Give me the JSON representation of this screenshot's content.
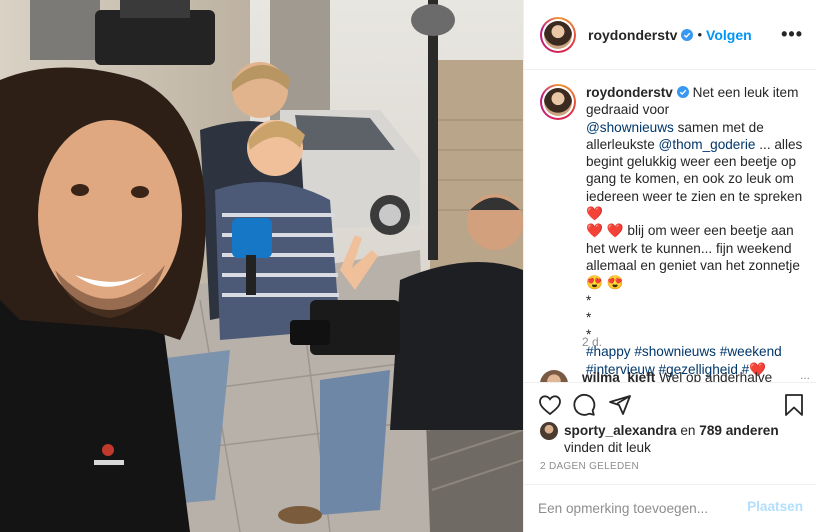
{
  "post": {
    "username": "roydonderstv",
    "follow_label": "Volgen",
    "separator": "•",
    "more_label": "•••",
    "photo_alt": "Selfie van een tv-ploeg met camera en microfoonhengel op straat"
  },
  "caption": {
    "username": "roydonderstv",
    "part1": "Net een leuk item gedraaid voor\n",
    "mention1": "@shownieuws",
    "part2": " samen met de allerleukste ",
    "mention2": "@thom_goderie",
    "part3": " ... alles begint gelukkig weer een beetje op gang te komen, en ook zo leuk om iedereen weer te zien en te spreken",
    "heart1": "❤️",
    "heart2": "❤️ ❤️",
    "part4": "  blij om weer een beetje aan het werk te kunnen... fijn weekend allemaal en geniet van het zonnetje",
    "emoji_end": "😍 😍",
    "bullets": "*\n*\n*",
    "hashtags": "#happy #shownieuws #weekend #intervieuw #gezelligheid #",
    "heart3": "❤️",
    "age": "2 d."
  },
  "comment_preview": {
    "username": "wilma_kieft",
    "text": "Wel op anderhalve",
    "more": "..."
  },
  "likes": {
    "user": "sporty_alexandra",
    "middle": " en ",
    "count": "789 anderen",
    "suffix": "vinden dit leuk"
  },
  "timestamp": "2 DAGEN GELEDEN",
  "comment_input": {
    "placeholder": "Een opmerking toevoegen...",
    "post_label": "Plaatsen"
  },
  "icons": {
    "verified": "verified-badge-icon",
    "like": "heart-icon",
    "comment": "comment-icon",
    "share": "paper-plane-icon",
    "save": "bookmark-icon"
  },
  "colors": {
    "accent": "#0095f6",
    "link": "#00376b",
    "muted": "#8e8e8e",
    "post_disabled": "#b2dffc",
    "heart": "#ed4956"
  }
}
